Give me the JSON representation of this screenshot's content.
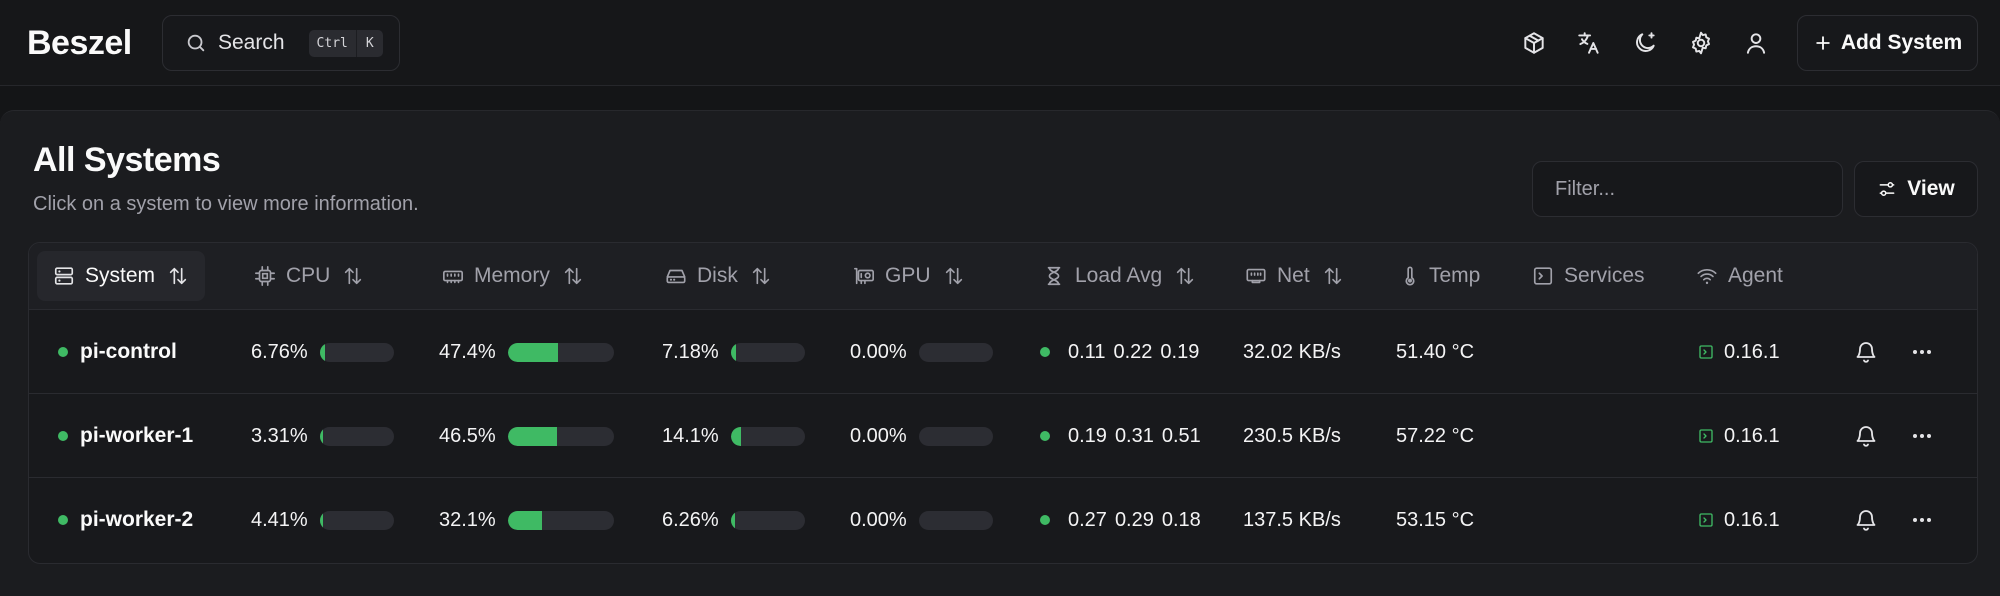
{
  "app": {
    "logo": "Beszel"
  },
  "header": {
    "search_label": "Search",
    "shortcut_keys": [
      "Ctrl",
      "K"
    ],
    "icons": [
      "cube-icon",
      "translate-icon",
      "theme-moon-icon",
      "settings-gear-icon",
      "user-icon"
    ],
    "add_system_label": "Add System"
  },
  "main": {
    "title": "All Systems",
    "subtitle": "Click on a system to view more information.",
    "filter_placeholder": "Filter...",
    "view_label": "View"
  },
  "table": {
    "columns": [
      {
        "label": "System",
        "icon": "server-icon",
        "sortable": true,
        "active": true
      },
      {
        "label": "CPU",
        "icon": "cpu-icon",
        "sortable": true
      },
      {
        "label": "Memory",
        "icon": "memory-icon",
        "sortable": true
      },
      {
        "label": "Disk",
        "icon": "hard-drive-icon",
        "sortable": true
      },
      {
        "label": "GPU",
        "icon": "gpu-icon",
        "sortable": true
      },
      {
        "label": "Load Avg",
        "icon": "hourglass-icon",
        "sortable": true
      },
      {
        "label": "Net",
        "icon": "ethernet-icon",
        "sortable": true
      },
      {
        "label": "Temp",
        "icon": "thermometer-icon",
        "sortable": false
      },
      {
        "label": "Services",
        "icon": "terminal-icon",
        "sortable": false
      },
      {
        "label": "Agent",
        "icon": "wifi-icon",
        "sortable": false
      }
    ],
    "rows": [
      {
        "name": "pi-control",
        "status": "up",
        "cpu": "6.76%",
        "cpu_pct": 6.76,
        "memory": "47.4%",
        "memory_pct": 47.4,
        "disk": "7.18%",
        "disk_pct": 7.18,
        "gpu": "0.00%",
        "gpu_pct": 0,
        "load": [
          "0.11",
          "0.22",
          "0.19"
        ],
        "net": "32.02 KB/s",
        "temp": "51.40 °C",
        "services": "",
        "agent": "0.16.1"
      },
      {
        "name": "pi-worker-1",
        "status": "up",
        "cpu": "3.31%",
        "cpu_pct": 3.31,
        "memory": "46.5%",
        "memory_pct": 46.5,
        "disk": "14.1%",
        "disk_pct": 14.1,
        "gpu": "0.00%",
        "gpu_pct": 0,
        "load": [
          "0.19",
          "0.31",
          "0.51"
        ],
        "net": "230.5 KB/s",
        "temp": "57.22 °C",
        "services": "",
        "agent": "0.16.1"
      },
      {
        "name": "pi-worker-2",
        "status": "up",
        "cpu": "4.41%",
        "cpu_pct": 4.41,
        "memory": "32.1%",
        "memory_pct": 32.1,
        "disk": "6.26%",
        "disk_pct": 6.26,
        "gpu": "0.00%",
        "gpu_pct": 0,
        "load": [
          "0.27",
          "0.29",
          "0.18"
        ],
        "net": "137.5 KB/s",
        "temp": "53.15 °C",
        "services": "",
        "agent": "0.16.1"
      }
    ]
  },
  "colors": {
    "accent_green": "#3fba64",
    "background": "#141517",
    "card": "#1b1c1f",
    "border": "#2a2b30",
    "muted_text": "#a1a1aa"
  }
}
